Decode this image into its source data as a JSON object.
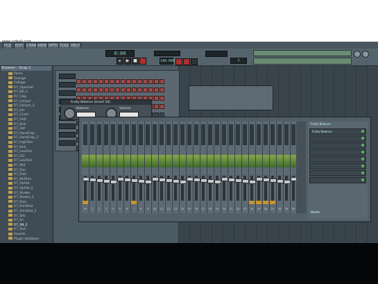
{
  "watermark": "www.videall.com",
  "menu": [
    "FILE",
    "EDIT",
    "CHANNELS",
    "VIEW",
    "OPTIONS",
    "TOOLS",
    "HELP"
  ],
  "toolbar": {
    "time_display": "0:00",
    "tempo": "140.000",
    "pattern": "1"
  },
  "browser": {
    "title": "Browser - Snap 1",
    "items": [
      "Packs",
      "Vintage",
      "Collage",
      "R7_OpenHat",
      "R7_BD_2",
      "R7_Clap",
      "R7_Chirper",
      "R7_Chirper_2",
      "R7_HH",
      "R7_Crash",
      "R7_HH2",
      "R7_Kick",
      "R7_Hat",
      "R7_HandClap",
      "R7_HandClap_2",
      "R7_HighTom",
      "R7_Kick",
      "R7_LowTom",
      "R7_LT2",
      "R7_LowTom",
      "R7_Mid",
      "R7_Rim",
      "R7_Ride",
      "R7_MidTom",
      "R7_OpHat",
      "R7_OpHat_2",
      "R7_Shaker",
      "R7_Shaker_2",
      "R7_Ride",
      "R7_RimShot",
      "R7_RimShot_2",
      "R7_Shk",
      "R7_Sn",
      "R7_SN_2",
      "R7_Tom",
      "Sounds",
      "Plugin database"
    ],
    "selected_index": 33
  },
  "plugin": {
    "title": "Fruity Balance (Insert 10)",
    "knob1": "Balance",
    "knob2": "Volume"
  },
  "mixer": {
    "strips": [
      "M",
      "1",
      "2",
      "3",
      "4",
      "5",
      "6",
      "7",
      "8",
      "9",
      "10",
      "11",
      "12",
      "13",
      "14",
      "15",
      "16",
      "17",
      "18",
      "19",
      "20",
      "21",
      "22",
      "23",
      "24",
      "25",
      "26",
      "27",
      "28",
      "29",
      "30"
    ],
    "orange_channels": [
      0,
      7,
      24,
      25,
      26,
      27
    ],
    "fx_title": "Fruity Balance",
    "fx_slots": [
      "Fruity Balance",
      "",
      "",
      "",
      "",
      "",
      "",
      ""
    ],
    "out_label": "Master"
  }
}
